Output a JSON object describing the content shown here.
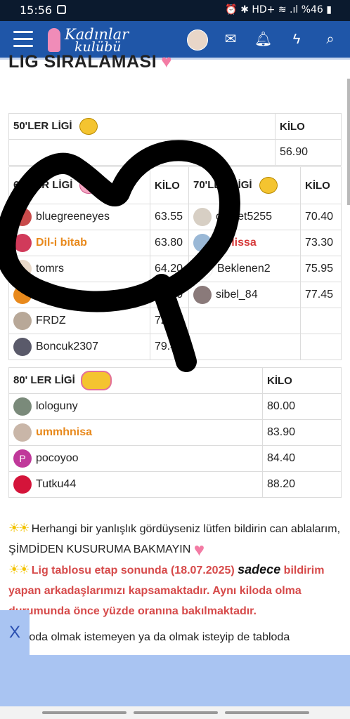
{
  "status": {
    "time": "15:56",
    "right": "⏰ ✱ HD+ ≋ .ıl %46 ▮"
  },
  "header": {
    "logo_line1": "Kadınlar",
    "logo_line2": "kulübü"
  },
  "page": {
    "title": "LIG SIRALAMASI"
  },
  "league50": {
    "title": "50'LER LİGİ",
    "kilo_header": "KİLO",
    "rows": [
      {
        "name": "",
        "value": "56.90"
      }
    ]
  },
  "league60": {
    "title": "60'LAR LİGİ",
    "kilo_header": "KİLO",
    "rows": [
      {
        "name": "bluegreeneyes",
        "value": "63.55"
      },
      {
        "name": "Dil-i bitab",
        "value": "63.80"
      },
      {
        "name": "tomrs",
        "value": "64.20"
      },
      {
        "name": "Deltaw",
        "value": "66.90"
      },
      {
        "name": "FRDZ",
        "value": "72"
      },
      {
        "name": "Boncuk2307",
        "value": "79.4"
      }
    ]
  },
  "league70": {
    "title": "70'LER LİGİ",
    "kilo_header": "KİLO",
    "rows": [
      {
        "name": "demet5255",
        "value": "70.40"
      },
      {
        "name": "Melissa",
        "value": "73.30"
      },
      {
        "name": "Beklenen2",
        "value": "75.95"
      },
      {
        "name": "sibel_84",
        "value": "77.45"
      }
    ]
  },
  "league80": {
    "title": "80' LER LİGİ",
    "kilo_header": "KİLO",
    "rows": [
      {
        "name": "lologuny",
        "value": "80.00"
      },
      {
        "name": "ummhnisa",
        "value": "83.90"
      },
      {
        "name": "pocoyoo",
        "value": "84.40"
      },
      {
        "name": "Tutku44",
        "value": "88.20"
      }
    ]
  },
  "notes": {
    "line1": "Herhangi bir yanlışlık gördüyseniz lütfen bildirin can ablalarım, ŞİMDİDEN KUSURUMA BAKMAYIN",
    "line2_red": "Lig tablosu etap sonunda (18.07.2025)",
    "line2_italic": "sadece",
    "line2_rest": "bildirim yapan arkadaşlarımızı kapsamaktadır. Aynı kiloda olma durumunda önce yüzde oranına bakılmaktadır.",
    "line3": "Tabloda olmak istemeyen ya da olmak isteyip de tabloda"
  },
  "ad": {
    "close": "X"
  },
  "colors": {
    "appbar": "#1f56a8",
    "orange_name": "#e8891c",
    "red_name": "#d63b3b",
    "ad_bg": "#a9c4f2"
  }
}
